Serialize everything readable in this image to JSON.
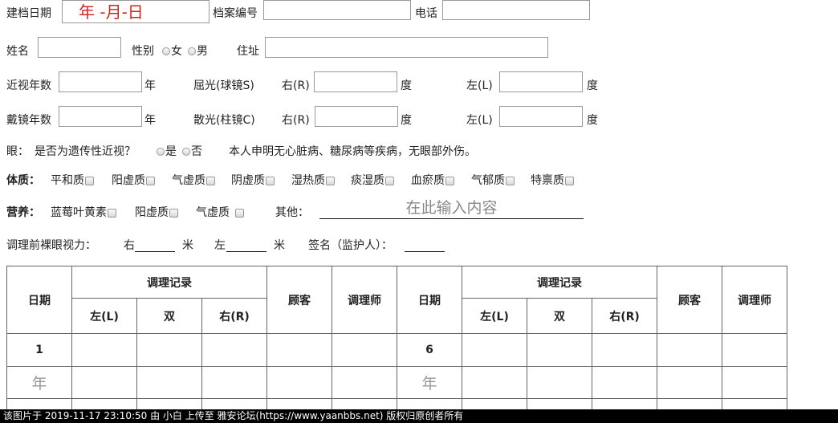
{
  "row1": {
    "date_label": "建档日期",
    "date_value": "年 -月-日",
    "file_no_label": "档案编号",
    "phone_label": "电话"
  },
  "row2": {
    "name_label": "姓名",
    "gender_label": "性别",
    "female": "女",
    "male": "男",
    "address_label": "住址"
  },
  "row3": {
    "myopia_years_label": "近视年数",
    "year_unit": "年",
    "sphere_label": "屈光(球镜S)",
    "right_label": "右(R)",
    "degree_unit": "度",
    "left_label": "左(L)"
  },
  "row4": {
    "glasses_years_label": "戴镜年数",
    "year_unit": "年",
    "cylinder_label": "散光(柱镜C)",
    "right_label": "右(R)",
    "degree_unit": "度",
    "left_label": "左(L)"
  },
  "row5": {
    "eye_label": "眼：",
    "hereditary_q": "是否为遗传性近视？",
    "yes": "是",
    "no": "否",
    "declaration": "本人申明无心脏病、糖尿病等疾病，无眼部外伤。"
  },
  "constitution": {
    "label": "体质：",
    "options": [
      "平和质",
      "阳虚质",
      "气虚质",
      "阴虚质",
      "湿热质",
      "痰湿质",
      "血瘀质",
      "气郁质",
      "特禀质"
    ]
  },
  "nutrition": {
    "label": "营养：",
    "options": [
      "蓝莓叶黄素",
      "阳虚质",
      "气虚质"
    ],
    "other_label": "其他：",
    "other_placeholder": "在此输入内容"
  },
  "vision": {
    "label": "调理前裸眼视力：",
    "right": "右",
    "unit": "米",
    "left": "左",
    "sign_label": "签名（监护人）："
  },
  "table": {
    "date_header": "日期",
    "record_header": "调理记录",
    "left_header": "左(L)",
    "both_header": "双",
    "right_header": "右(R)",
    "customer_header": "顾客",
    "therapist_header": "调理师",
    "row1_left_no": "1",
    "row1_right_no": "6",
    "year_placeholder": "年"
  },
  "footer": {
    "text": "该图片于 2019-11-17 23:10:50 由 小白 上传至 雅安论坛(https://www.yaanbbs.net) 版权归原创者所有"
  }
}
